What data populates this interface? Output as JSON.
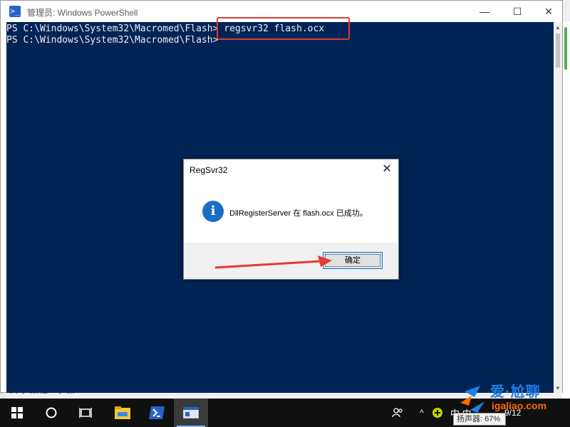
{
  "window": {
    "title": "管理员: Windows PowerShell",
    "icon": "powershell-icon",
    "controls": {
      "minimize": "—",
      "maximize": "☐",
      "close": "✕"
    }
  },
  "console": {
    "lines": [
      "PS C:\\Windows\\System32\\Macromed\\Flash> regsvr32 flash.ocx",
      "PS C:\\Windows\\System32\\Macromed\\Flash>"
    ],
    "colors": {
      "background": "#012456",
      "text": "#eeedf0",
      "highlight": "#e53935"
    }
  },
  "dialog": {
    "title": "RegSvr32",
    "close": "✕",
    "icon": "info-icon",
    "icon_glyph": "i",
    "message": "DllRegisterServer 在 flash.ocx 已成功。",
    "ok_label": "确定"
  },
  "taskbar": {
    "items": [
      "start-icon",
      "search-icon",
      "task-view-icon",
      "file-explorer-icon",
      "powershell-icon",
      "regsvr32-window-icon"
    ],
    "tray": {
      "people": "people-icon",
      "chevron": "^",
      "lang": "中 中",
      "date": "9/12",
      "volume_tip": "扬声器: 67%"
    }
  },
  "watermark": {
    "text": "爱·尬聊",
    "url": "igaliao.com"
  },
  "desktop_hint": "大/小 数 选 // 小 数"
}
